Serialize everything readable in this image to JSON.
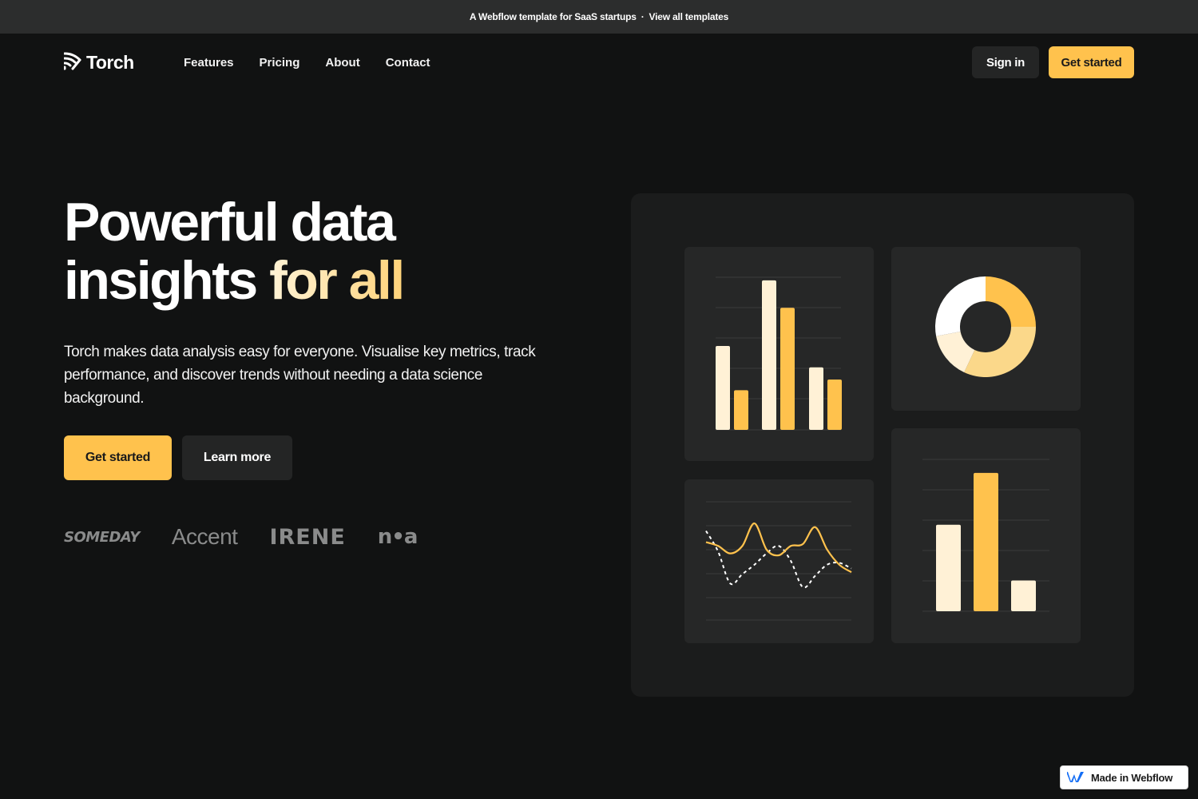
{
  "topbar": {
    "text": "A Webflow template for SaaS startups",
    "separator": "·",
    "link": "View all templates"
  },
  "nav": {
    "logo_text": "Torch",
    "links": [
      "Features",
      "Pricing",
      "About",
      "Contact"
    ],
    "sign_in": "Sign in",
    "get_started": "Get started"
  },
  "hero": {
    "title_line1": "Powerful data",
    "title_line2_plain": "insights ",
    "title_line2_accent": "for all",
    "description": "Torch makes data analysis easy for everyone. Visualise key metrics, track performance, and discover trends without needing a data science background.",
    "primary_cta": "Get started",
    "secondary_cta": "Learn more"
  },
  "client_logos": [
    "SOMEDAY",
    "Accent",
    "IRENE",
    "n•a"
  ],
  "colors": {
    "background": "#111212",
    "accent_yellow": "#ffc24d",
    "accent_light": "#fff1d6",
    "donut_mid": "#fbd88a",
    "panel": "#1b1c1c",
    "card": "#262727"
  },
  "chart_data": [
    {
      "type": "bar",
      "series": [
        {
          "values": [
            5.5,
            9.8,
            4.1
          ]
        },
        {
          "values": [
            2.6,
            8.0,
            3.3
          ]
        }
      ]
    },
    {
      "type": "pie",
      "donut": true,
      "values": [
        25,
        32,
        15,
        28
      ]
    },
    {
      "type": "line",
      "x": [
        0,
        1,
        2,
        3,
        4,
        5,
        6,
        7,
        8,
        9,
        10,
        11,
        12
      ],
      "series": [
        {
          "values": [
            3.2,
            3.0,
            2.6,
            3.0,
            4.2,
            2.8,
            2.5,
            3.0,
            3.1,
            4.0,
            2.8,
            2.0,
            1.6
          ]
        },
        {
          "values": [
            3.8,
            2.7,
            1.0,
            1.5,
            2.0,
            2.6,
            3.0,
            2.2,
            0.8,
            1.4,
            2.0,
            2.1,
            1.8
          ]
        }
      ]
    },
    {
      "type": "bar",
      "values": [
        4.5,
        7.2,
        1.6
      ]
    }
  ],
  "badge": {
    "text": "Made in Webflow",
    "icon": "webflow-logo-icon"
  }
}
